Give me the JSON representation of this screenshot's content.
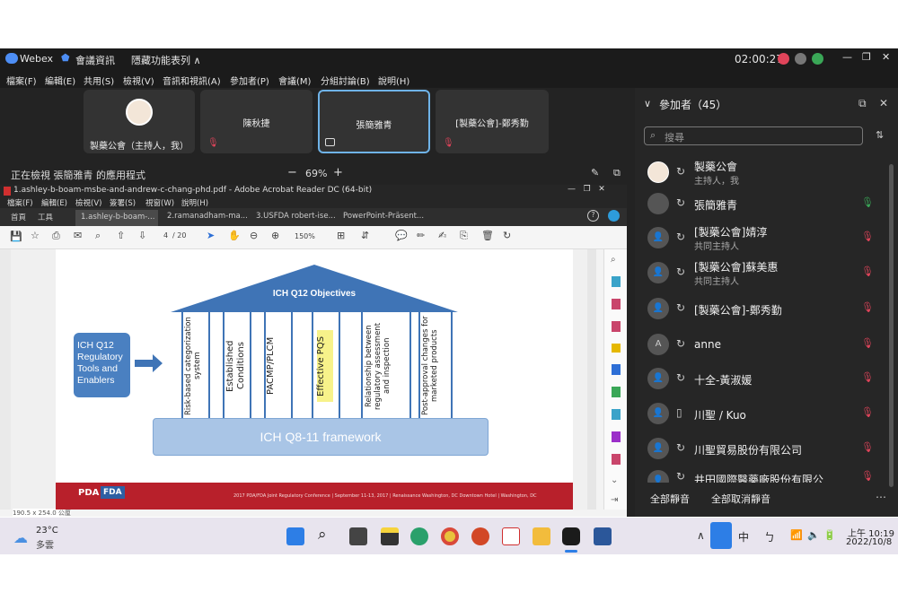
{
  "window": {
    "app": "Webex",
    "meeting_info": "會議資訊",
    "hide_bar": "隱藏功能表列 ∧",
    "clock": "02:00:27"
  },
  "menu": [
    "檔案(F)",
    "編輯(E)",
    "共用(S)",
    "檢視(V)",
    "音訊和視訊(A)",
    "參加者(P)",
    "會議(M)",
    "分組討論(B)",
    "說明(H)"
  ],
  "tiles": [
    {
      "name": "製藥公會（主持人，我）"
    },
    {
      "name": "陳秋捷"
    },
    {
      "name": "張簡雅青"
    },
    {
      "name": "[製藥公會]-鄭秀勤"
    }
  ],
  "share": {
    "status": "正在檢視 張簡雅青 的應用程式",
    "zoom": "69%",
    "minus": "−",
    "plus": "+"
  },
  "acrobat": {
    "title": "1.ashley-b-boam-msbe-and-andrew-c-chang-phd.pdf - Adobe Acrobat Reader DC (64-bit)",
    "menu": [
      "檔案(F)",
      "編輯(E)",
      "檢視(V)",
      "簽署(S)",
      "視窗(W)",
      "說明(H)"
    ],
    "home": "首頁",
    "tools": "工具",
    "tabs": [
      "1.ashley-b-boam-...",
      "2.ramanadham-ma...",
      "3.USFDA robert-ise...",
      "PowerPoint-Präsent..."
    ],
    "page": "4",
    "total": "/ 20",
    "zoom": "150%",
    "size": "190.5 x 254.0 公厘"
  },
  "slide": {
    "roof": "ICH Q12 Objectives",
    "tools": "ICH Q12 Regulatory Tools and Enablers",
    "pillars": [
      "Risk-based categorization system",
      "Established Conditions",
      "PACMP/PLCM",
      "Effective PQS",
      "Relationship between regulatory assessment and inspection",
      "Post-approval changes for marketed products"
    ],
    "base": "ICH Q8-11 framework",
    "footer": "2017 PDA/FDA Joint Regulatory Conference | September 11-13, 2017 | Renaissance Washington, DC Downtown Hotel | Washington, DC",
    "logo1": "PDA",
    "logo2": "FDA"
  },
  "participants": {
    "title": "參加者（45）",
    "search_placeholder": "搜尋",
    "list": [
      {
        "name": "製藥公會",
        "sub": "主持人，我"
      },
      {
        "name": "張簡雅青",
        "sub": ""
      },
      {
        "name": "[製藥公會]婧淳",
        "sub": "共同主持人"
      },
      {
        "name": "[製藥公會]蘇美惠",
        "sub": "共同主持人"
      },
      {
        "name": "[製藥公會]-鄭秀勤",
        "sub": ""
      },
      {
        "name": "anne",
        "sub": "",
        "initial": "A"
      },
      {
        "name": "十全-黃淑媛",
        "sub": ""
      },
      {
        "name": "川聖 / Kuo",
        "sub": ""
      },
      {
        "name": "川聖貿易股份有限公司",
        "sub": ""
      },
      {
        "name": "井田國際醫藥廠股份有限公",
        "sub": ""
      }
    ],
    "mute_all": "全部靜音",
    "unmute_all": "全部取消靜音"
  },
  "taskbar": {
    "temp": "23°C",
    "weather": "多雲",
    "ime1": "中",
    "ime2": "ㄅ",
    "time": "上午 10:19",
    "date": "2022/10/8"
  },
  "colors": {
    "accent": "#4a90e2",
    "mute": "#e0445a",
    "slide_blue": "#3f74b6"
  }
}
